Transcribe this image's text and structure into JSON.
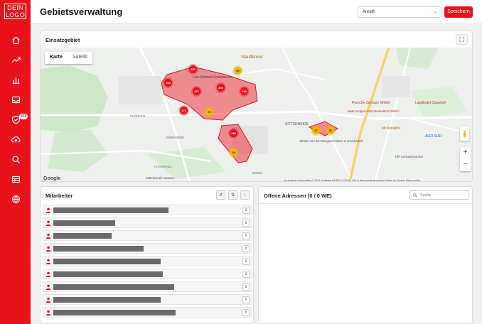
{
  "logo": {
    "line1": "DEIN",
    "line2": "LOGO"
  },
  "sidebar": {
    "items": [
      {
        "icon": "home-icon"
      },
      {
        "icon": "trending-icon"
      },
      {
        "icon": "bar-chart-icon"
      },
      {
        "icon": "inbox-icon"
      },
      {
        "icon": "shield-check-icon",
        "badge": "439"
      },
      {
        "icon": "upload-cloud-icon"
      },
      {
        "icon": "search-icon"
      },
      {
        "icon": "table-icon"
      },
      {
        "icon": "globe-icon"
      }
    ]
  },
  "header": {
    "title": "Gebietsverwaltung",
    "select_value": "Anrath",
    "save_label": "Speichern"
  },
  "map_card": {
    "title": "Einsatzgebiet",
    "tabs": {
      "map": "Karte",
      "satellite": "Satellit"
    },
    "attribution": "Kurzbefehle   Kartendaten © 2023 GeoBasis-DE/BKG (©2009)   200 m   Nutzungsbedingungen   Fehler bei Google Maps melden",
    "google": "Google",
    "place_labels": {
      "stauffenner": "Stauffenner",
      "gymnasium": "Lise-Meitner-Gymnasium",
      "clorath": "CLÖRATH",
      "vennheide": "VENNHEIDE",
      "sittersheide": "SITTERHEIDE",
      "porsche": "Porsche Zentrum Willich",
      "budget_hotel": "B&B budget Hotel Düsseldorf Willich",
      "landhotel": "Landhotel Classhof",
      "mcdonalds": "McDonald's",
      "aldi": "ALDI SÜD",
      "hifi": "Hifi Schluderbacher",
      "imkerei": "Johann van den Bongard Imkerei & Imkerbedarf",
      "hagwinkel": "HAGWINKEL",
      "bokel": "BÖKEL",
      "mittelschule": "Mittelschule Stauten"
    },
    "markers": [
      {
        "label": "203",
        "color": "#e8121b"
      },
      {
        "label": "90",
        "color": "#f2b400"
      },
      {
        "label": "283",
        "color": "#e8121b"
      },
      {
        "label": "257",
        "color": "#e8121b"
      },
      {
        "label": "280",
        "color": "#e8121b"
      },
      {
        "label": "299",
        "color": "#e8121b"
      },
      {
        "label": "171",
        "color": "#e8121b"
      },
      {
        "label": "74",
        "color": "#f2b400"
      },
      {
        "label": "250",
        "color": "#e8121b"
      },
      {
        "label": "26",
        "color": "#f2b400"
      },
      {
        "label": "75",
        "color": "#f2b400"
      },
      {
        "label": "47",
        "color": "#f2b400"
      }
    ]
  },
  "employees": {
    "title": "Mitarbeiter",
    "rows": [
      {
        "redacted_fraction": 0.61
      },
      {
        "redacted_fraction": 0.33
      },
      {
        "redacted_fraction": 0.31
      },
      {
        "redacted_fraction": 0.48
      },
      {
        "redacted_fraction": 0.57
      },
      {
        "redacted_fraction": 0.58
      },
      {
        "redacted_fraction": 0.64
      },
      {
        "redacted_fraction": 0.57
      },
      {
        "redacted_fraction": 0.65
      }
    ]
  },
  "addresses": {
    "title": "Offene Adressen (0 / 0 WE)",
    "search_placeholder": "Suche"
  },
  "colors": {
    "brand": "#e8121b",
    "marker_yellow": "#f2b400"
  }
}
